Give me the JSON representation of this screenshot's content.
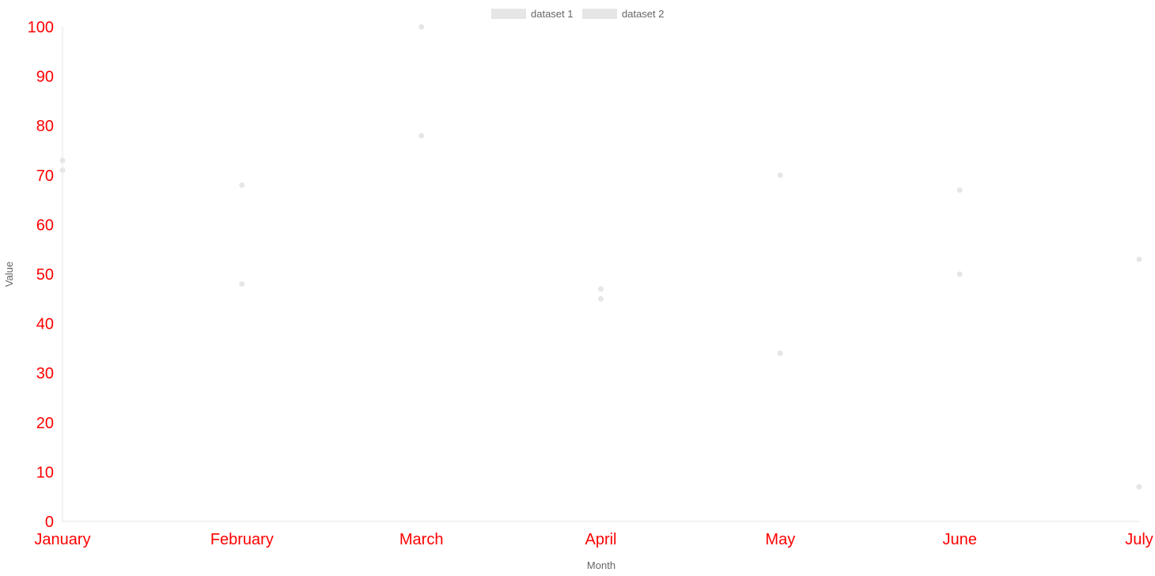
{
  "colors": {
    "tick_label": "#ff0000",
    "axis_title": "#666666",
    "axis_line": "#e6e6e6",
    "point": "#e6e6e6",
    "legend_swatch": "#e6e6e6"
  },
  "chart_data": {
    "type": "scatter",
    "title": "",
    "categories": [
      "January",
      "February",
      "March",
      "April",
      "May",
      "June",
      "July"
    ],
    "series": [
      {
        "name": "dataset 1",
        "values": [
          73,
          48,
          100,
          47,
          70,
          50,
          53
        ]
      },
      {
        "name": "dataset 2",
        "values": [
          71,
          68,
          78,
          45,
          34,
          67,
          7
        ]
      }
    ],
    "xlabel": "Month",
    "ylabel": "Value",
    "ylim": [
      0,
      100
    ],
    "yticks": [
      "0",
      "10",
      "20",
      "30",
      "40",
      "50",
      "60",
      "70",
      "80",
      "90",
      "100"
    ],
    "grid": false,
    "legend_position": "top-center"
  }
}
